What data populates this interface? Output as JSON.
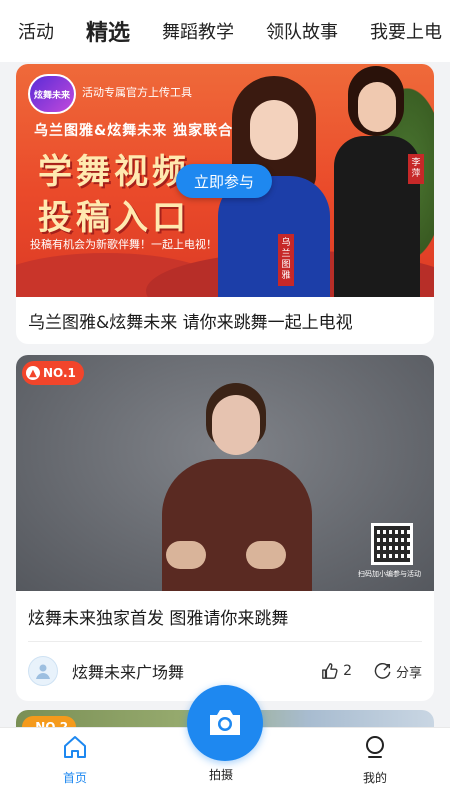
{
  "tabs": [
    {
      "label": "活动",
      "active": false
    },
    {
      "label": "精选",
      "active": true
    },
    {
      "label": "舞蹈教学",
      "active": false
    },
    {
      "label": "领队故事",
      "active": false
    },
    {
      "label": "我要上电",
      "active": false
    }
  ],
  "card1": {
    "logo_text": "炫舞未来",
    "tool_tag": "活动专属官方上传工具",
    "sub_head": "乌兰图雅&炫舞未来 独家联合",
    "headline_line1": "学舞视频",
    "headline_line2": "投稿入口",
    "slogan": "投稿有机会为新歌伴舞！一起上电视！",
    "join_button": "立即参与",
    "name_tag_a": "乌兰图雅",
    "name_tag_b": "李萍",
    "title": "乌兰图雅&炫舞未来 请你来跳舞一起上电视"
  },
  "card2": {
    "rank_badge": "NO.1",
    "qr_caption": "扫码加小编参与活动",
    "title": "炫舞未来独家首发 图雅请你来跳舞",
    "author": "炫舞未来广场舞",
    "likes": "2",
    "share_label": "分享"
  },
  "card3": {
    "rank_badge": "NO.2"
  },
  "bottom_nav": {
    "home": "首页",
    "shoot": "拍摄",
    "mine": "我的"
  },
  "colors": {
    "accent": "#1e88f0",
    "badge_red": "#f2452b",
    "badge_orange": "#f59a1b"
  }
}
